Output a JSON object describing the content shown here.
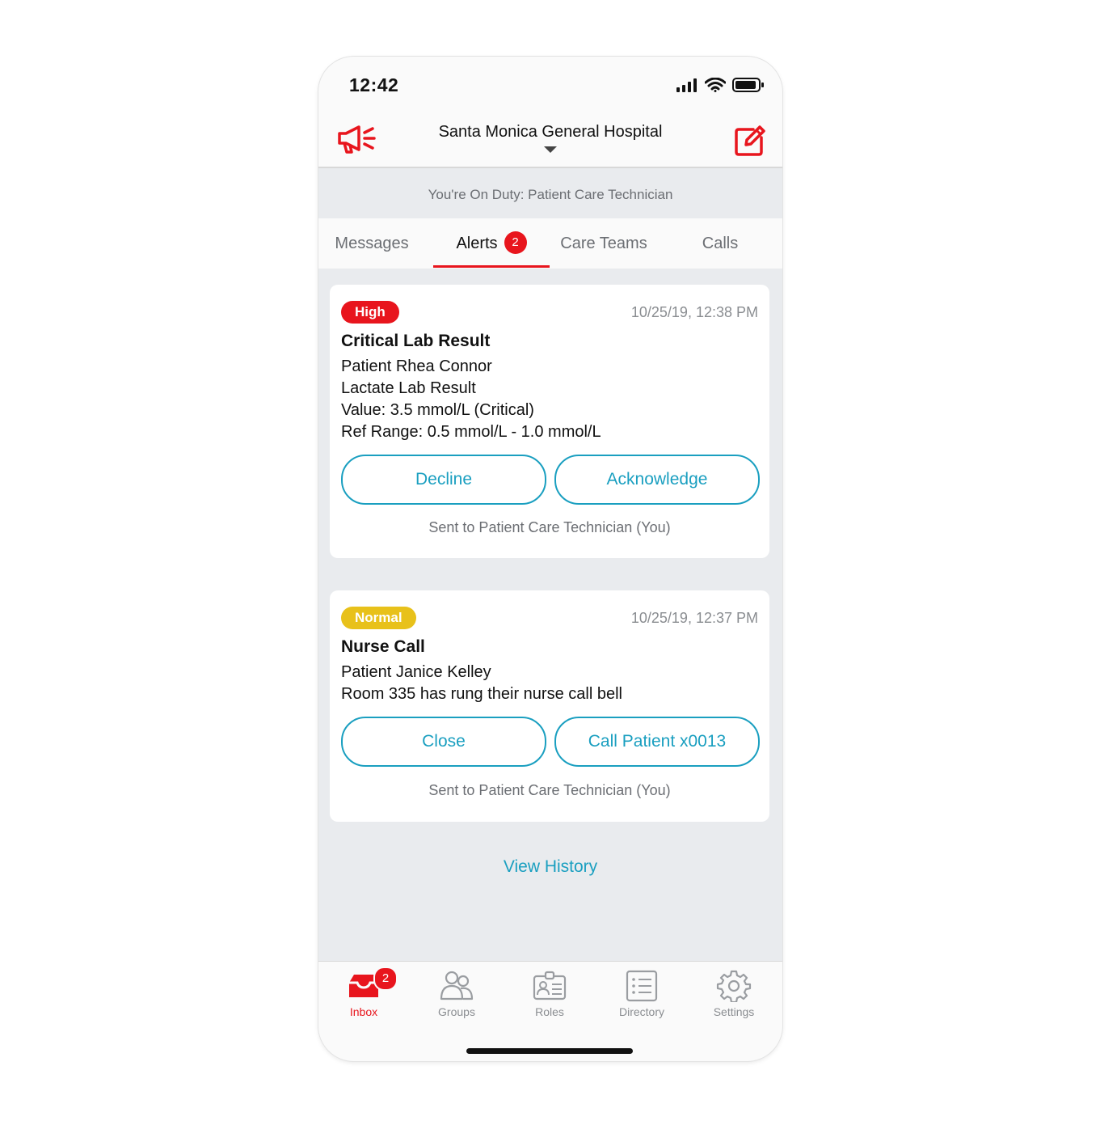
{
  "status_bar": {
    "time": "12:42"
  },
  "header": {
    "hospital_name": "Santa Monica General Hospital",
    "announce_icon": "megaphone-icon",
    "compose_icon": "compose-icon"
  },
  "duty_banner": {
    "text": "You're On Duty: Patient Care Technician"
  },
  "tabs": [
    {
      "label": "Messages",
      "active": false
    },
    {
      "label": "Alerts",
      "active": true,
      "badge": "2"
    },
    {
      "label": "Care Teams",
      "active": false
    },
    {
      "label": "Calls",
      "active": false
    }
  ],
  "alerts": [
    {
      "priority": "High",
      "priority_color": "#e8151d",
      "timestamp": "10/25/19, 12:38 PM",
      "title": "Critical Lab Result",
      "lines": [
        "Patient Rhea Connor",
        "Lactate Lab Result",
        "Value: 3.5 mmol/L (Critical)",
        "Ref Range: 0.5 mmol/L - 1.0 mmol/L"
      ],
      "buttons": [
        "Decline",
        "Acknowledge"
      ],
      "sent_to": "Sent to Patient Care Technician (You)"
    },
    {
      "priority": "Normal",
      "priority_color": "#e8c11a",
      "timestamp": "10/25/19, 12:37 PM",
      "title": "Nurse Call",
      "lines": [
        "Patient Janice Kelley",
        "Room 335 has rung their nurse call bell"
      ],
      "buttons": [
        "Close",
        "Call Patient x0013"
      ],
      "sent_to": "Sent to Patient Care Technician (You)"
    }
  ],
  "view_history": "View History",
  "bottom_nav": [
    {
      "label": "Inbox",
      "icon": "inbox-icon",
      "active": true,
      "badge": "2"
    },
    {
      "label": "Groups",
      "icon": "groups-icon",
      "active": false
    },
    {
      "label": "Roles",
      "icon": "roles-icon",
      "active": false
    },
    {
      "label": "Directory",
      "icon": "directory-icon",
      "active": false
    },
    {
      "label": "Settings",
      "icon": "settings-icon",
      "active": false
    }
  ],
  "colors": {
    "accent_red": "#e8151d",
    "link_blue": "#1a9fc0",
    "normal_yellow": "#e8c11a"
  }
}
